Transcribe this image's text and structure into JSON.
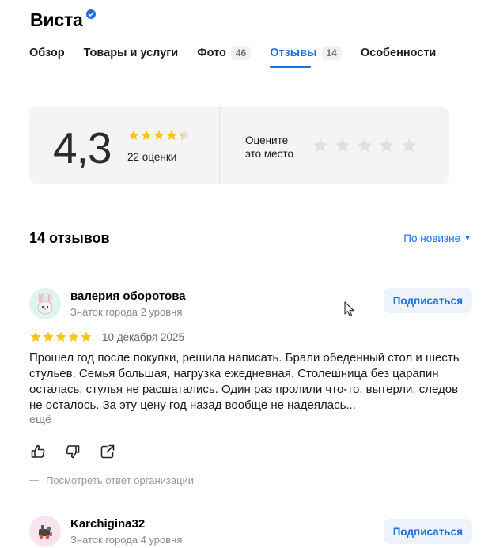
{
  "header": {
    "title": "Виста"
  },
  "tabs": [
    {
      "label": "Обзор"
    },
    {
      "label": "Товары и услуги"
    },
    {
      "label": "Фото",
      "count": "46"
    },
    {
      "label": "Отзывы",
      "count": "14",
      "active": true
    },
    {
      "label": "Особенности"
    }
  ],
  "rating": {
    "value": "4,3",
    "stars": 4.3,
    "count_text": "22 оценки",
    "rate_prompt_line1": "Оцените",
    "rate_prompt_line2": "это место"
  },
  "reviews_header": {
    "count_label": "14 отзывов",
    "sort_label": "По новизне"
  },
  "reviews": [
    {
      "avatar_icon": "bunny-avatar-icon",
      "author": "валерия оборотова",
      "level": "Знаток города 2 уровня",
      "subscribe_label": "Подписаться",
      "stars": 5,
      "date": "10 декабря 2025",
      "text": "Прошел год после покупки, решила написать. Брали обеденный стол и шесть стульев. Семья большая, нагрузка ежедневная. Столешница без царапин осталась, стулья не расшатались. Один раз пролили что-то, вытерли, следов не осталось. За эту цену год назад вообще не надеялась...",
      "more_label": "ещё",
      "org_reply_label": "Посмотреть ответ организации"
    },
    {
      "avatar_icon": "train-avatar-icon",
      "author": "Karchigina32",
      "level": "Знаток города 4 уровня",
      "subscribe_label": "Подписаться"
    }
  ],
  "colors": {
    "accent": "#1a6fe5",
    "star": "#fcc419",
    "star_empty": "#e0e0e0",
    "card_bg": "#f4f4f4"
  }
}
